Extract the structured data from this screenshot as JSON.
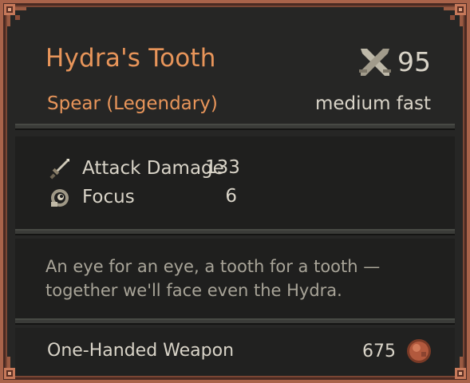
{
  "item": {
    "name": "Hydra's Tooth",
    "type_line": "Spear (Legendary)",
    "speed": "medium fast",
    "weight_icon": "crossed-weapons-icon",
    "weight": "95"
  },
  "stats": [
    {
      "icon": "sword-icon",
      "label": "Attack Damage",
      "value": "133"
    },
    {
      "icon": "spiral-focus-icon",
      "label": "Focus",
      "value": "6"
    }
  ],
  "description": "An eye for an eye, a tooth for a tooth — together we'll face even the Hydra.",
  "footer": {
    "category": "One-Handed Weapon",
    "price": "675",
    "currency_icon": "copper-coin-icon"
  },
  "colors": {
    "title": "#e8955a",
    "text": "#d9d4c8",
    "description": "#a8a498",
    "frame": "#a9634a",
    "panel": "#262625"
  }
}
